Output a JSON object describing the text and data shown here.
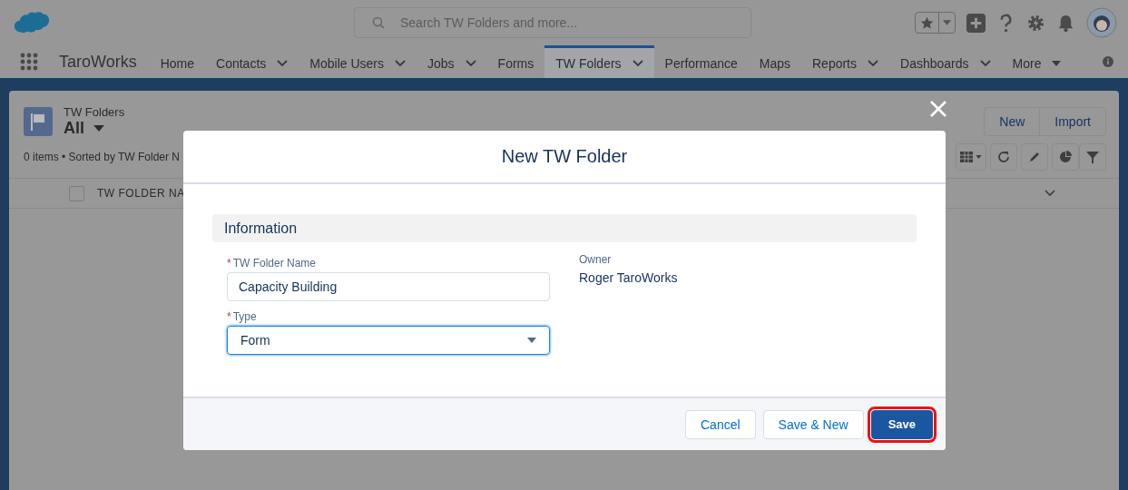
{
  "header": {
    "search": {
      "placeholder": "Search TW Folders and more..."
    }
  },
  "nav": {
    "app_name": "TaroWorks",
    "items": [
      {
        "label": "Home",
        "kind": "link",
        "selected": false
      },
      {
        "label": "Contacts",
        "kind": "dropdown",
        "selected": false
      },
      {
        "label": "Mobile Users",
        "kind": "dropdown",
        "selected": false
      },
      {
        "label": "Jobs",
        "kind": "dropdown",
        "selected": false
      },
      {
        "label": "Forms",
        "kind": "link",
        "selected": false
      },
      {
        "label": "TW Folders",
        "kind": "dropdown",
        "selected": true
      },
      {
        "label": "Performance",
        "kind": "link",
        "selected": false
      },
      {
        "label": "Maps",
        "kind": "link",
        "selected": false
      },
      {
        "label": "Reports",
        "kind": "dropdown",
        "selected": false
      },
      {
        "label": "Dashboards",
        "kind": "dropdown",
        "selected": false
      },
      {
        "label": "More",
        "kind": "overflow",
        "selected": false
      }
    ]
  },
  "list_view": {
    "object_name": "TW Folders",
    "view_name": "All",
    "status": "0 items • Sorted by TW Folder N",
    "buttons": [
      "New",
      "Import"
    ],
    "column": "TW FOLDER NA",
    "select_all": {
      "checked": false
    }
  },
  "modal": {
    "title": "New TW Folder",
    "section": "Information",
    "fields": [
      {
        "kind": "text",
        "label": "TW Folder Name",
        "required_mark": "*",
        "value": "Capacity Building",
        "focused": false
      },
      {
        "kind": "select",
        "label": "Type",
        "required_mark": "*",
        "value": "Form",
        "focused": true
      }
    ],
    "owner": {
      "label": "Owner",
      "value": "Roger TaroWorks"
    },
    "buttons": [
      {
        "label": "Cancel",
        "kind": "neutral",
        "highlighted": false
      },
      {
        "label": "Save & New",
        "kind": "neutral",
        "highlighted": false
      },
      {
        "label": "Save",
        "kind": "brand",
        "highlighted": true
      }
    ]
  }
}
